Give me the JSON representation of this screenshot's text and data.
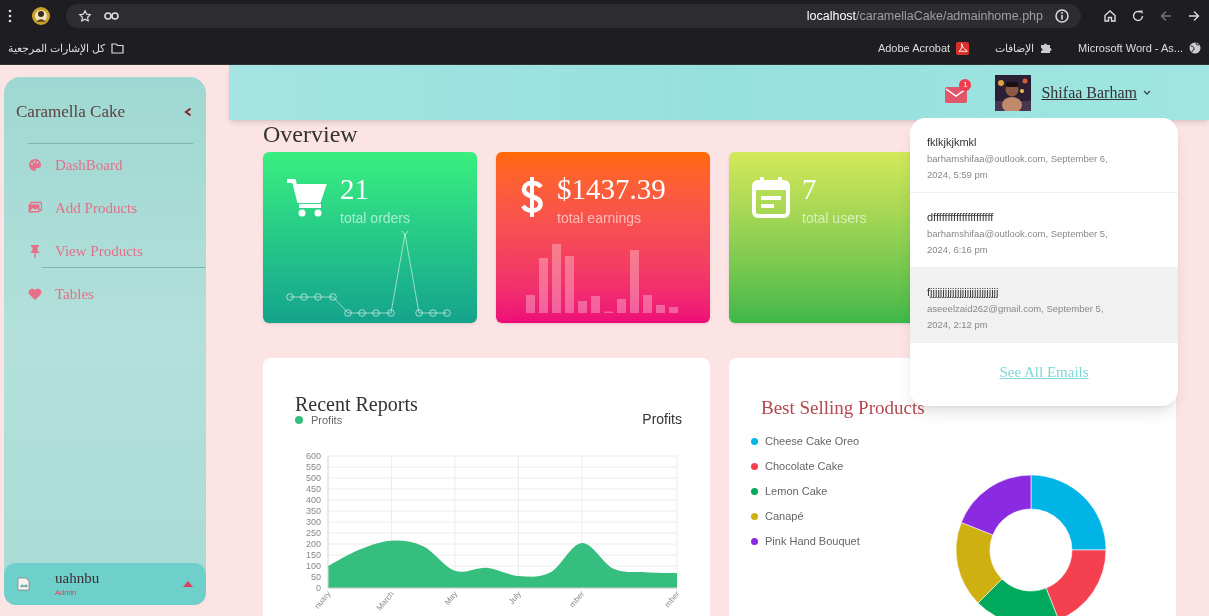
{
  "browser": {
    "url_host": "localhost",
    "url_path": "/caramellaCake/admainhome.php",
    "bookmarks": [
      {
        "label": "كل الإشارات المرجعية",
        "kind": "folder"
      },
      {
        "label": "Adobe Acrobat",
        "kind": "pdf"
      },
      {
        "label": "الإضافات",
        "kind": "extensions"
      },
      {
        "label": "Microsoft Word - As...",
        "kind": "globe"
      }
    ]
  },
  "sidebar": {
    "title": "Caramella Cake",
    "items": [
      {
        "label": "DashBoard"
      },
      {
        "label": "Add Products"
      },
      {
        "label": "View Products"
      },
      {
        "label": "Tables"
      }
    ],
    "user": {
      "name": "uahnbu",
      "role": "Admin"
    }
  },
  "header": {
    "mail_badge": "1",
    "user_name": "Shifaa Barham"
  },
  "overview_title": "Overview",
  "stats": [
    {
      "value": "21",
      "label": "total orders",
      "kind": "orders"
    },
    {
      "value": "$1437.39",
      "label": "total earnings",
      "kind": "earnings"
    },
    {
      "value": "7",
      "label": "total users",
      "kind": "users"
    }
  ],
  "mail_dropdown": {
    "messages": [
      {
        "subject": "fklkjkjkmkl",
        "meta": "barhamshifaa@outlook.com, September 6, 2024, 5:59 pm",
        "highlighted": false
      },
      {
        "subject": "dfffffffffffffffffffff",
        "meta": "barhamshifaa@outlook.com, September 5, 2024, 6:16 pm",
        "highlighted": false
      },
      {
        "subject": "fjjjjjjjjjjjjjjjjjjjjjjjjjjjj",
        "meta": "aseeelzaid262@gmail.com, September 5, 2024, 2:12 pm",
        "highlighted": true
      }
    ],
    "link": "See All Emails"
  },
  "recent_reports": {
    "title": "Recent Reports",
    "chart_data": {
      "type": "area",
      "title": "Profits",
      "categories": [
        "nuary",
        null,
        "March",
        null,
        "May",
        null,
        "July",
        null,
        "mber",
        null,
        null,
        "mber"
      ],
      "series": [
        {
          "name": "Profits",
          "color": "#36be7e",
          "values": [
            100,
            175,
            215,
            190,
            78,
            92,
            55,
            70,
            205,
            88,
            72,
            68
          ]
        }
      ],
      "grid": true,
      "ylim": [
        0,
        600
      ],
      "yticks": [
        0,
        50,
        100,
        150,
        200,
        250,
        300,
        350,
        400,
        450,
        500,
        550,
        600
      ]
    }
  },
  "best_selling": {
    "title": "Best Selling Products",
    "legend": [
      {
        "label": "Cheese Cake Oreo",
        "color": "#00b4e6"
      },
      {
        "label": "Chocolate Cake",
        "color": "#f5414f"
      },
      {
        "label": "Lemon Cake",
        "color": "#00a95c"
      },
      {
        "label": "Canapé",
        "color": "#cfb011"
      },
      {
        "label": "Pink Hand Bouquet",
        "color": "#8a2be2"
      }
    ]
  }
}
